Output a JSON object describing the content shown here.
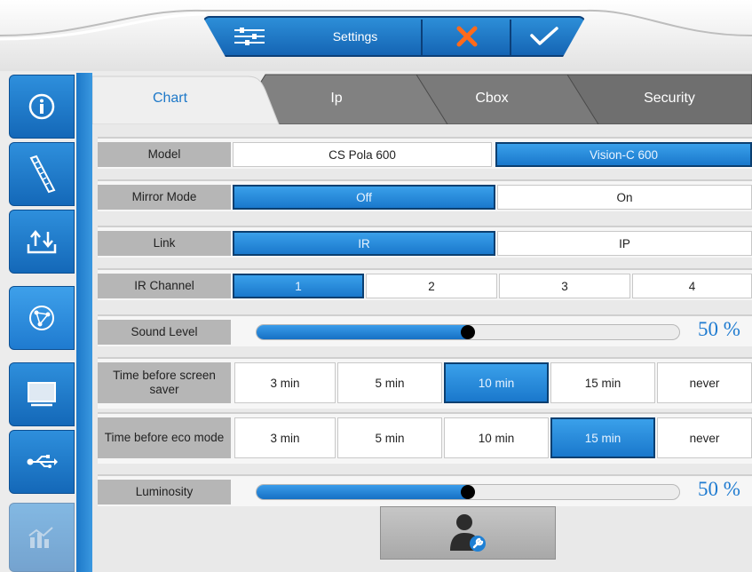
{
  "topbar": {
    "title": "Settings",
    "icons": [
      "sliders-icon",
      "close-icon",
      "check-icon"
    ]
  },
  "sidebar": {
    "items": [
      {
        "name": "info-icon"
      },
      {
        "name": "ruler-icon"
      },
      {
        "name": "transfer-icon"
      },
      {
        "name": "network-icon"
      },
      {
        "name": "monitor-icon"
      },
      {
        "name": "usb-icon"
      },
      {
        "name": "chart-icon"
      }
    ]
  },
  "tabs": [
    {
      "label": "Chart"
    },
    {
      "label": "Ip"
    },
    {
      "label": "Cbox"
    },
    {
      "label": "Security"
    }
  ],
  "settings": {
    "model": {
      "label": "Model",
      "options": [
        "CS Pola 600",
        "Vision-C 600"
      ],
      "selected": "Vision-C 600"
    },
    "mirror": {
      "label": "Mirror Mode",
      "options": [
        "Off",
        "On"
      ],
      "selected": "Off"
    },
    "link": {
      "label": "Link",
      "options": [
        "IR",
        "IP"
      ],
      "selected": "IR"
    },
    "ir_channel": {
      "label": "IR Channel",
      "options": [
        "1",
        "2",
        "3",
        "4"
      ],
      "selected": "1"
    },
    "sound": {
      "label": "Sound Level",
      "value": 50,
      "display": "50 %"
    },
    "screensaver": {
      "label": "Time before screen saver",
      "options": [
        "3 min",
        "5 min",
        "10 min",
        "15 min",
        "never"
      ],
      "selected": "10 min"
    },
    "eco": {
      "label": "Time before eco mode",
      "options": [
        "3 min",
        "5 min",
        "10 min",
        "15 min",
        "never"
      ],
      "selected": "15 min"
    },
    "luminosity": {
      "label": "Luminosity",
      "value": 50,
      "display": "50 %"
    }
  },
  "colors": {
    "accent": "#1d78c8",
    "selected": "#2a8ad8",
    "label_bg": "#b6b6b6"
  }
}
